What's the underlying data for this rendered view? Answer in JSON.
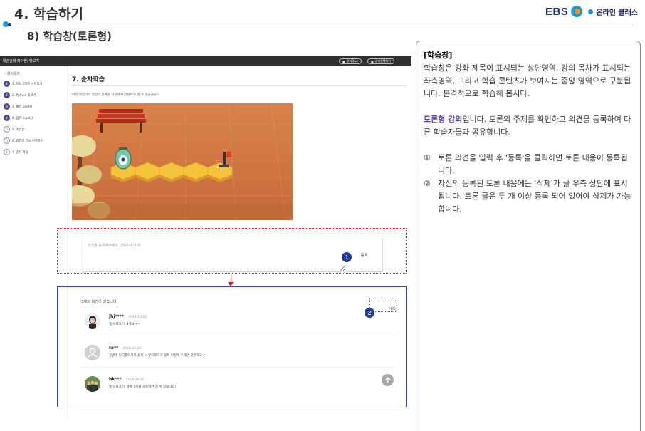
{
  "doc": {
    "title": "4. 학습하기",
    "subtitle": "8) 학습창(토론형)",
    "logo_text": "온라인 클래스",
    "logo_brand": "EBS"
  },
  "screenshot": {
    "appbar": {
      "title": "내손안의 파이썬: 맛보기",
      "qa_button": "강좌Q&A",
      "progress_button": "강좌진행하기"
    },
    "sidebar": {
      "back_label": "강의목차",
      "items": [
        {
          "icon": "1",
          "label": "1. 프로그래밍 시작하기"
        },
        {
          "icon": "2",
          "label": "2. Python 맛보기"
        },
        {
          "icon": "3",
          "label": "3. 출력 print()"
        },
        {
          "icon": "4",
          "label": "4. 입력 input()"
        },
        {
          "icon": "5",
          "label": "5. 조건문"
        },
        {
          "icon": "6",
          "label": "6. 컴퓨터 기능 반복하기"
        },
        {
          "icon": "7",
          "label": "7. 순차 학습"
        }
      ]
    },
    "lesson": {
      "title": "7. 순차학습",
      "question": "어떤 명령어의 명령어 블록을 사용해서 만들어지 잘 수 있을까요?"
    },
    "opinion": {
      "placeholder": "의견을 등록해주세요. (500자 이내)",
      "register_label": "등록"
    },
    "comments": {
      "count_label": "3개의 의견이 있습니다.",
      "delete_label": "삭제",
      "items": [
        {
          "user": "jhj****",
          "date": "2018.10.22",
          "text": "'앞으로가기' 4개요~~"
        },
        {
          "user": "te**",
          "date": "2018.10.22",
          "text": "깃발에 다다를때까지 블록 + 앞으로가기 블록 어떻게 두개면 충분해요~"
        },
        {
          "user": "hk***",
          "date": "2018.10.22",
          "text": "'앞으로가기' 블록 4개를 사용하면 갈 수 있습니다!"
        }
      ]
    }
  },
  "badges": {
    "one": "1",
    "two": "2"
  },
  "explain": {
    "heading": "[학습창]",
    "p1": "학습창은 강좌 제목이 표시되는 상단영역, 강의 목차가 표시되는 좌측영역, 그리고 학습 콘텐츠가 보여지는 중앙 영역으로 구분됩니다. 본격적으로 학습해 봅시다.",
    "p2_highlight": "토론형 강의",
    "p2_rest": "입니다. 토론의 주제를 확인하고 의견을 등록하여 다른 학습자들과 공유합니다.",
    "items": [
      {
        "num": "①",
        "text": "토론 의견을 입력 후 '등록'을 클릭하면 토론 내용이 등록됩니다."
      },
      {
        "num": "②",
        "text": "자신의 등록된 토론 내용에는 '삭제'가 글 우측 상단에 표시됩니다. 토론 글은 두 개 이상 등록 되어 있어야 삭제가 가능합니다."
      }
    ]
  },
  "colors": {
    "accent_red": "#d81f26",
    "accent_blue": "#1e3a9b",
    "highlight_purple": "#5a3eb0"
  }
}
